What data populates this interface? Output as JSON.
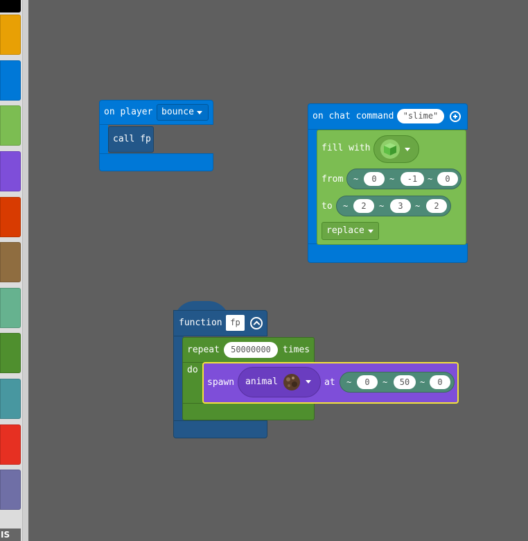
{
  "toolbox": {
    "categories": [
      {
        "color": "#000000"
      },
      {
        "color": "#e8a005"
      },
      {
        "color": "#0078d7"
      },
      {
        "color": "#7cbd52"
      },
      {
        "color": "#7e4ed9"
      },
      {
        "color": "#d83b01"
      },
      {
        "color": "#8f6d40"
      },
      {
        "color": "#66b28f"
      },
      {
        "color": "#4f8f2e"
      },
      {
        "color": "#4897a0"
      },
      {
        "color": "#e63022"
      },
      {
        "color": "#6f6fa6"
      }
    ],
    "bottom_label": "IS"
  },
  "colors": {
    "workspace": "#5f5f5f",
    "event_blue": "#0078d7",
    "function_blue": "#235789",
    "blocks_green": "#7cbd52",
    "loops_green": "#4f8f2e",
    "mobs_purple": "#7e4ed9",
    "position_teal": "#4d8a77",
    "selection_yellow": "#f4e23c"
  },
  "block_player": {
    "label": "on player",
    "dropdown": "bounce",
    "call_label": "call fp"
  },
  "block_chat": {
    "label": "on chat command",
    "command": "\"slime\"",
    "fill_label": "fill with",
    "fill_icon": "slime-block-icon",
    "from_label": "from",
    "from_values": [
      "0",
      "-1",
      "0"
    ],
    "to_label": "to",
    "to_values": [
      "2",
      "3",
      "2"
    ],
    "tilde": "~",
    "mode": "replace"
  },
  "block_function": {
    "label": "function",
    "name": "fp",
    "repeat_label": "repeat",
    "repeat_count": "50000000",
    "times_label": "times",
    "do_label": "do",
    "spawn_label": "spawn",
    "animal_label": "animal",
    "animal_icon": "animal-head-icon",
    "at_label": "at",
    "at_values": [
      "0",
      "50",
      "0"
    ]
  }
}
